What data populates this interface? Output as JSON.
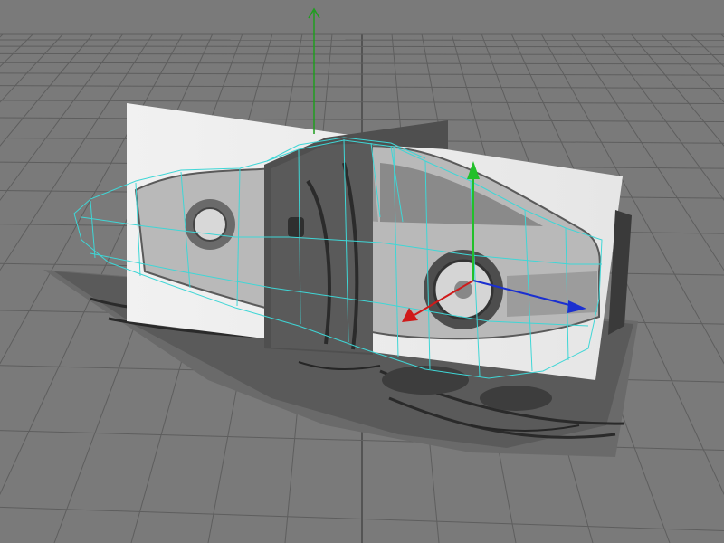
{
  "viewport": {
    "view": "perspective",
    "background_color": "#7a7a7a",
    "grid_color": "#5e5e5e",
    "grid_major_color": "#454545",
    "wireframe_color": "#3fd6d6",
    "manipulator": {
      "up_axis_color": "#1f9e1f",
      "x_axis_color": "#1a2fd0",
      "y_axis_color": "#22c02a",
      "z_axis_color": "#d01a1a"
    }
  },
  "objects": [
    {
      "name": "ground-image-plane",
      "kind": "reference-blueprint",
      "view": "top"
    },
    {
      "name": "side-image-plane",
      "kind": "reference-blueprint",
      "view": "side"
    },
    {
      "name": "front-image-plane",
      "kind": "reference-blueprint",
      "view": "front"
    },
    {
      "name": "car-body-mesh",
      "kind": "polygon-mesh",
      "selected": true
    }
  ]
}
